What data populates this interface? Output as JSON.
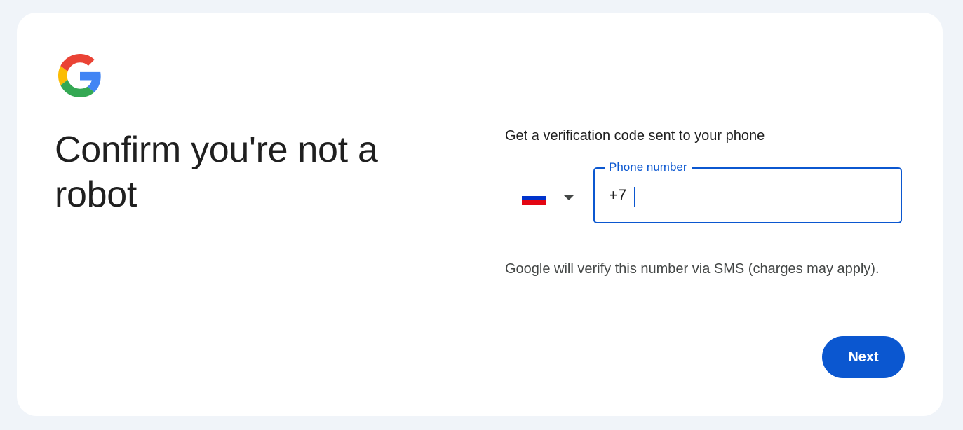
{
  "brand": {
    "logo_icon": "google-g-logo",
    "colors": {
      "blue": "#4285f4",
      "red": "#ea4335",
      "yellow": "#fbbc05",
      "green": "#34a853"
    }
  },
  "page": {
    "title": "Confirm you're not a robot"
  },
  "verification": {
    "subtitle": "Get a verification code sent to your phone",
    "country": {
      "flag_icon": "russia-flag-icon",
      "flag_colors": [
        "#ffffff",
        "#0033cc",
        "#e30613"
      ]
    },
    "phone": {
      "label": "Phone number",
      "value": "+7"
    },
    "hint": "Google will verify this number via SMS (charges may apply).",
    "next_label": "Next"
  },
  "theme": {
    "accent": "#0b57d0",
    "background": "#f0f4f9",
    "card": "#ffffff"
  }
}
